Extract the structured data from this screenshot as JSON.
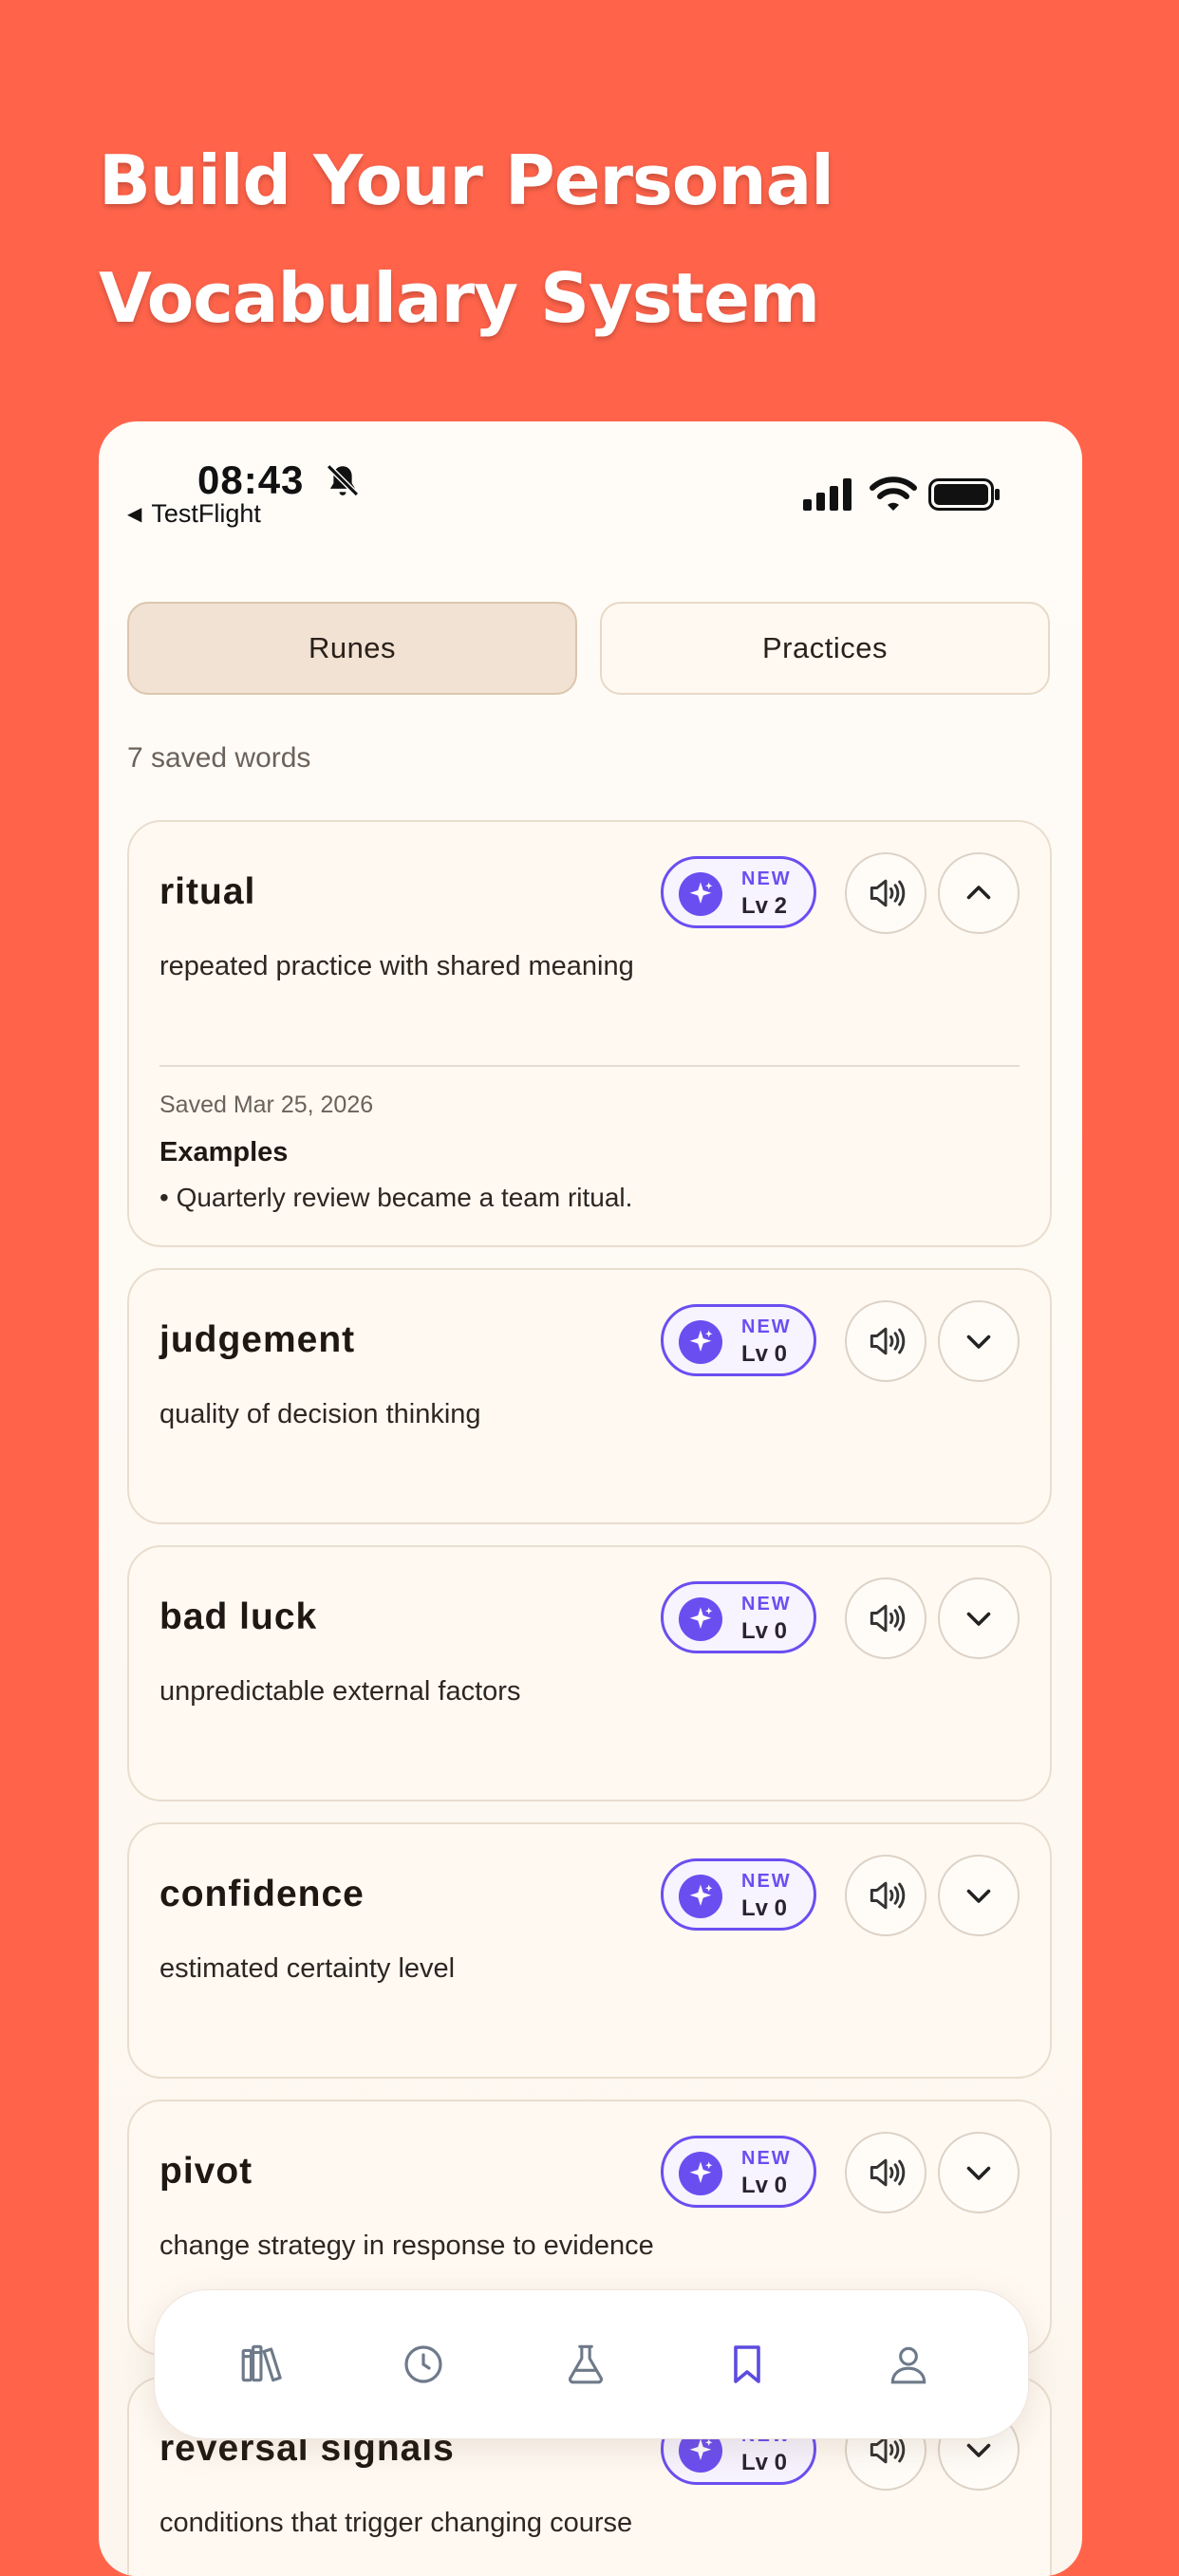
{
  "headline": {
    "line1": "Build Your Personal",
    "line2": "Vocabulary System"
  },
  "status_bar": {
    "time": "08:43",
    "back_app": "TestFlight"
  },
  "tabs": [
    {
      "label": "Runes",
      "active": true
    },
    {
      "label": "Practices",
      "active": false
    }
  ],
  "saved_count": "7 saved words",
  "words": [
    {
      "word": "ritual",
      "definition": "repeated practice with shared meaning",
      "status": "NEW",
      "level": "Lv 2",
      "expanded": true,
      "saved": "Saved Mar 25, 2026",
      "examples_heading": "Examples",
      "examples": [
        "• Quarterly review became a team ritual."
      ]
    },
    {
      "word": "judgement",
      "definition": "quality of decision thinking",
      "status": "NEW",
      "level": "Lv 0",
      "expanded": false
    },
    {
      "word": "bad luck",
      "definition": "unpredictable external factors",
      "status": "NEW",
      "level": "Lv 0",
      "expanded": false
    },
    {
      "word": "confidence",
      "definition": "estimated certainty level",
      "status": "NEW",
      "level": "Lv 0",
      "expanded": false
    },
    {
      "word": "pivot",
      "definition": "change strategy in response to evidence",
      "status": "NEW",
      "level": "Lv 0",
      "expanded": false
    },
    {
      "word": "reversal signals",
      "definition": "conditions that trigger changing course",
      "status": "NEW",
      "level": "Lv 0",
      "expanded": false
    }
  ],
  "bottom_nav": [
    {
      "icon": "library-icon",
      "active": false
    },
    {
      "icon": "history-clock-icon",
      "active": false
    },
    {
      "icon": "flask-icon",
      "active": false
    },
    {
      "icon": "bookmark-icon",
      "active": true
    },
    {
      "icon": "profile-icon",
      "active": false
    }
  ],
  "colors": {
    "background": "#FF644B",
    "accent": "#6B4EF0",
    "nav_active": "#5B4BE0",
    "nav_inactive": "#6E7A8A"
  }
}
